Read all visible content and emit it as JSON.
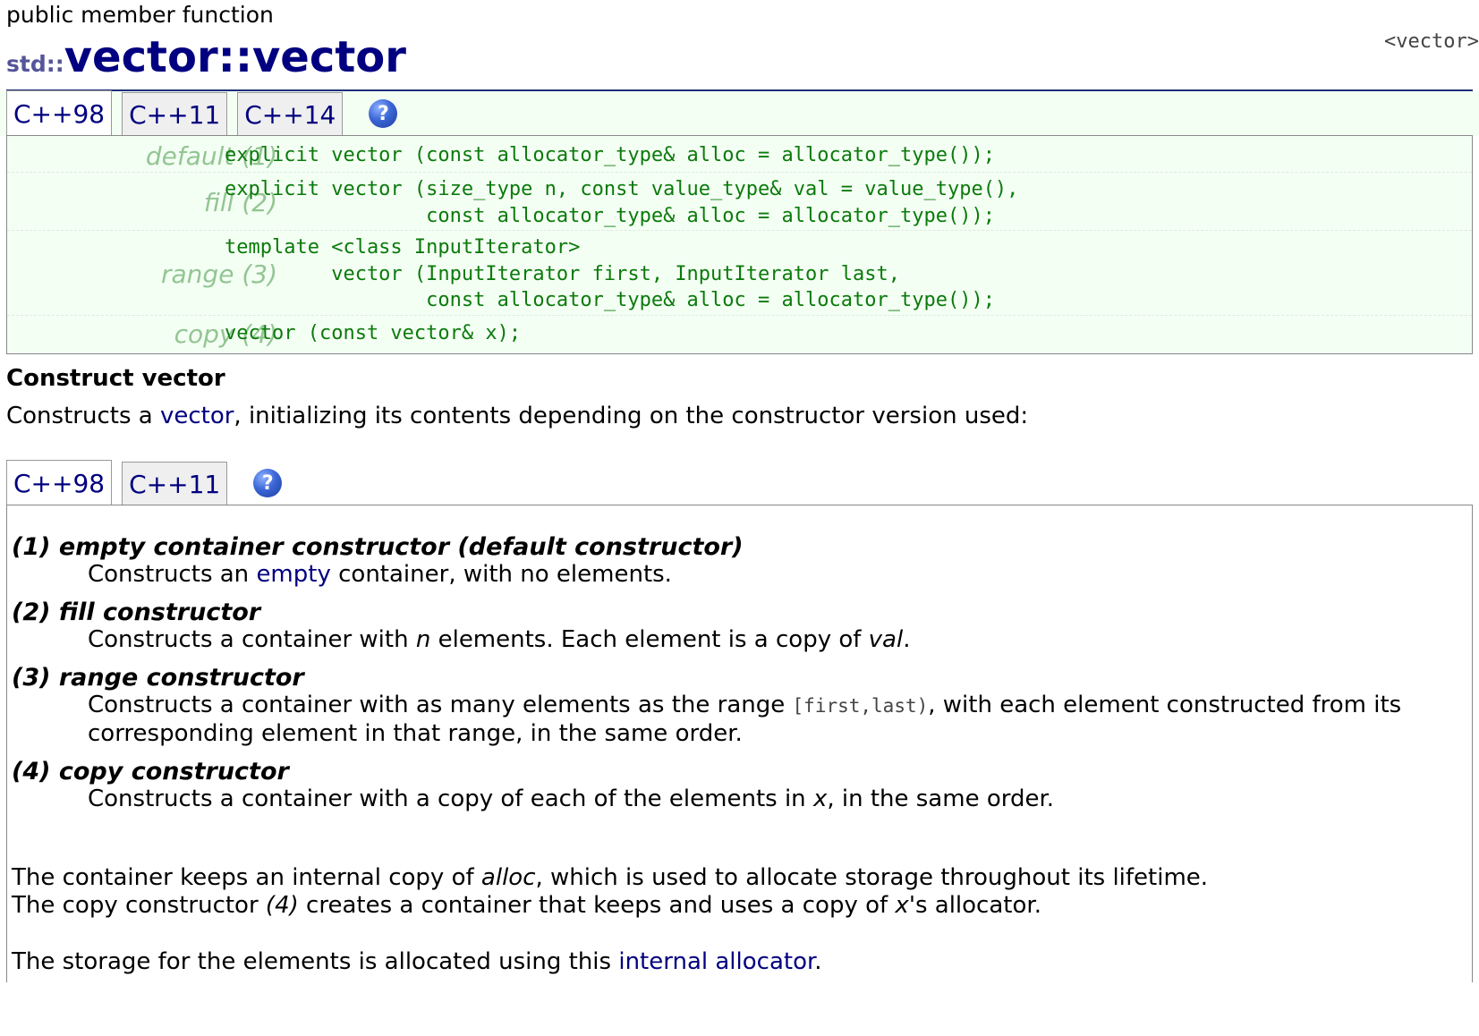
{
  "header": {
    "kind": "public member function",
    "namespace": "std::",
    "function_name": "vector::vector",
    "header_tag": "<vector>"
  },
  "prototype_tabs": {
    "items": [
      "C++98",
      "C++11",
      "C++14"
    ],
    "active_index": 0,
    "help_icon": "help-icon",
    "help_glyph": "?"
  },
  "prototypes": [
    {
      "label": "default (1)",
      "lines": [
        "explicit vector (const allocator_type& alloc = allocator_type());"
      ]
    },
    {
      "label": "fill (2)",
      "lines": [
        "explicit vector (size_type n, const value_type& val = value_type(),",
        "                 const allocator_type& alloc = allocator_type());"
      ]
    },
    {
      "label": "range (3)",
      "lines": [
        "template <class InputIterator>",
        "         vector (InputIterator first, InputIterator last,",
        "                 const allocator_type& alloc = allocator_type());"
      ]
    },
    {
      "label": "copy (4)",
      "lines": [
        "vector (const vector& x);"
      ]
    }
  ],
  "section": {
    "title": "Construct vector",
    "intro_before": "Constructs a ",
    "intro_link": "vector",
    "intro_after": ", initializing its contents depending on the constructor version used:"
  },
  "description_tabs": {
    "items": [
      "C++98",
      "C++11"
    ],
    "active_index": 0,
    "help_icon": "help-icon",
    "help_glyph": "?"
  },
  "constructors": {
    "c1": {
      "heading": "(1) empty container constructor (default constructor)",
      "t1": "Constructs an ",
      "link": "empty",
      "t2": " container, with no elements."
    },
    "c2": {
      "heading": "(2) fill constructor",
      "t1": "Constructs a container with ",
      "n": "n",
      "t2": " elements. Each element is a copy of ",
      "val": "val",
      "t3": "."
    },
    "c3": {
      "heading": "(3) range constructor",
      "t1": "Constructs a container with as many elements as the range ",
      "range": "[first,last)",
      "t2": ", with each element constructed from its corresponding element in that range, in the same order."
    },
    "c4": {
      "heading": "(4) copy constructor",
      "t1": "Constructs a container with a copy of each of the elements in ",
      "x": "x",
      "t2": ", in the same order."
    }
  },
  "notes": {
    "alloc_before": "The container keeps an internal copy of ",
    "alloc_word": "alloc",
    "alloc_after": ", which is used to allocate storage throughout its lifetime.",
    "copy_before": "The copy constructor ",
    "copy_ref": "(4)",
    "copy_mid": " creates a container that keeps and uses a copy of ",
    "copy_x": "x",
    "copy_after": "'s allocator.",
    "storage_before": "The storage for the elements is allocated using this ",
    "storage_link": "internal allocator",
    "storage_after": "."
  }
}
